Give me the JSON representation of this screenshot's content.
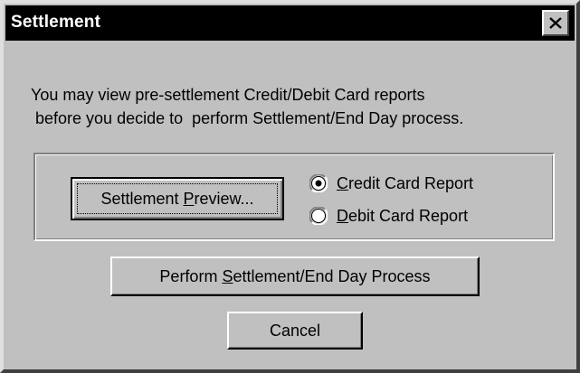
{
  "window": {
    "title": "Settlement",
    "close_icon": "close-icon"
  },
  "message": {
    "line1": "You may view pre-settlement Credit/Debit Card reports",
    "line2": " before you decide to  perform Settlement/End Day process."
  },
  "preview_button": {
    "label_before": "Settlement ",
    "label_mnemonic": "P",
    "label_after": "review..."
  },
  "report_options": [
    {
      "mnemonic": "C",
      "label_rest": "redit Card Report",
      "selected": true
    },
    {
      "mnemonic": "D",
      "label_rest": "ebit Card Report",
      "selected": false
    }
  ],
  "settle_button": {
    "label_before": "Perform ",
    "label_mnemonic": "S",
    "label_after": "ettlement/End Day Process"
  },
  "cancel_button": {
    "label": "Cancel"
  },
  "colors": {
    "dialog_face": "#c0c0c0",
    "titlebar": "#000000",
    "title_text": "#ffffff"
  }
}
